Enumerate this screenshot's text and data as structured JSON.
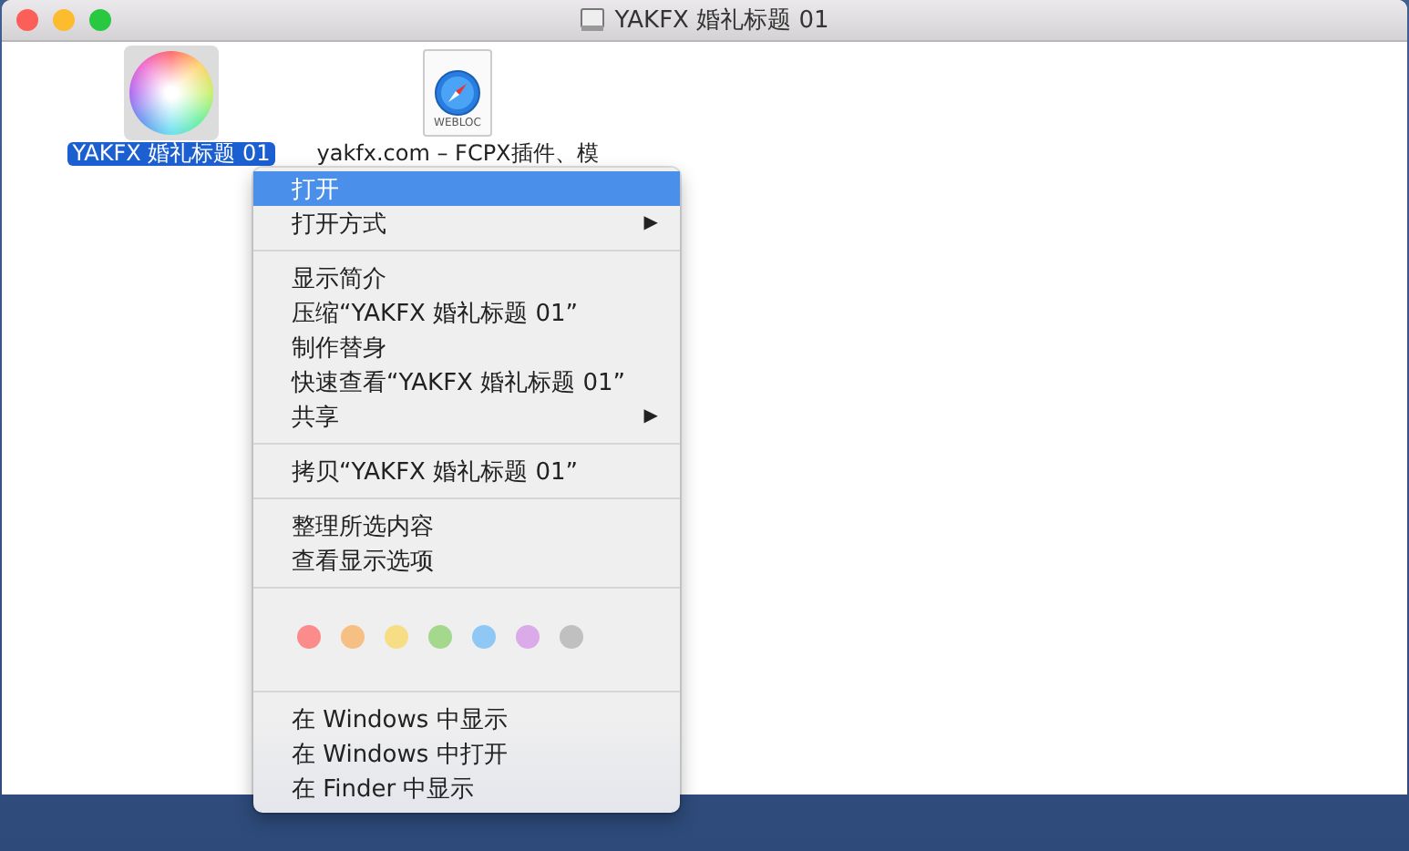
{
  "window": {
    "title": "YAKFX 婚礼标题 01"
  },
  "files": [
    {
      "kind": "colorwheel",
      "name": "YAKFX 婚礼标题 01",
      "selected": true
    },
    {
      "kind": "webloc",
      "name": "yakfx.com – FCPX插件、模",
      "badge": "WEBLOC",
      "selected": false
    }
  ],
  "context_menu": {
    "sections": [
      {
        "items": [
          {
            "label": "打开",
            "selected": true
          },
          {
            "label": "打开方式",
            "selected": false,
            "arrow": "▶"
          }
        ]
      },
      {
        "items": [
          {
            "label": "显示简介",
            "selected": false
          },
          {
            "label": "压缩“YAKFX 婚礼标题 01”",
            "selected": false
          },
          {
            "label": "制作替身",
            "selected": false
          },
          {
            "label": "快速查看“YAKFX 婚礼标题 01”",
            "selected": false
          },
          {
            "label": "共享",
            "selected": false,
            "arrow": "▶"
          }
        ]
      },
      {
        "items": [
          {
            "label": "拷贝“YAKFX 婚礼标题 01”",
            "selected": false
          }
        ]
      },
      {
        "items": [
          {
            "label": "整理所选内容",
            "selected": false
          },
          {
            "label": "查看显示选项",
            "selected": false
          }
        ]
      },
      {
        "tags": [
          {
            "color": "#fc8b8c"
          },
          {
            "color": "#f6bf84"
          },
          {
            "color": "#f7de85"
          },
          {
            "color": "#a4d88c"
          },
          {
            "color": "#8fc8f4"
          },
          {
            "color": "#dbaae8"
          },
          {
            "color": "#c0c0c0"
          }
        ]
      },
      {
        "items": [
          {
            "label": "在 Windows 中显示",
            "selected": false
          },
          {
            "label": "在 Windows 中打开",
            "selected": false
          },
          {
            "label": "在 Finder 中显示",
            "selected": false
          }
        ]
      }
    ]
  }
}
